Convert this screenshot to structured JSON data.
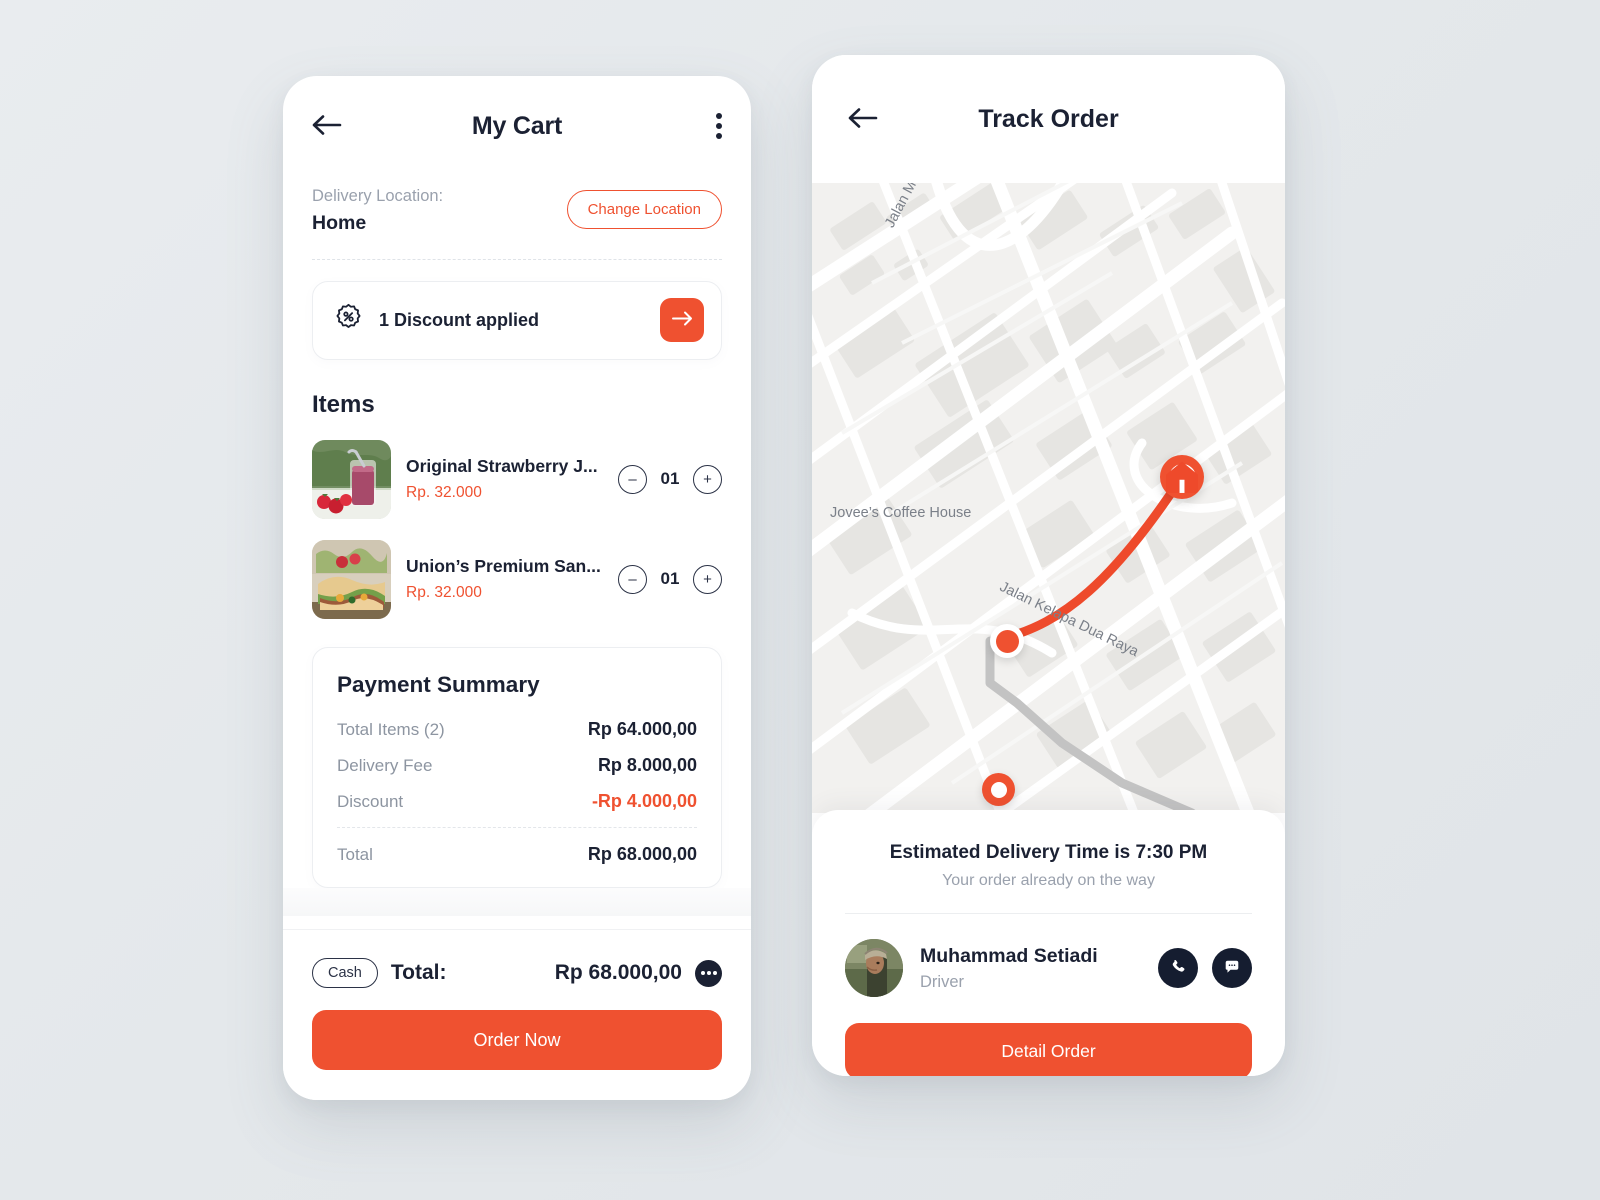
{
  "theme": {
    "accent": "#ef5130",
    "dark": "#1b2133",
    "muted": "#9aa1ad",
    "page_bg": "#e6e9ec"
  },
  "cart": {
    "title": "My Cart",
    "back_icon": "arrow-left-icon",
    "menu_icon": "more-vertical-icon",
    "delivery": {
      "label": "Delivery Location:",
      "value": "Home",
      "change_button": "Change Location"
    },
    "discount": {
      "icon": "discount-badge-icon",
      "text": "1 Discount applied",
      "action_icon": "arrow-right-icon"
    },
    "items_heading": "Items",
    "items": [
      {
        "name": "Original Strawberry J...",
        "price": "Rp. 32.000",
        "quantity": "01",
        "decrement": "–",
        "increment": "+",
        "thumb": "strawberry-smoothie-photo"
      },
      {
        "name": "Union’s Premium San...",
        "price": "Rp. 32.000",
        "quantity": "01",
        "decrement": "–",
        "increment": "+",
        "thumb": "sandwich-photo"
      }
    ],
    "payment_summary": {
      "title": "Payment Summary",
      "rows": [
        {
          "key": "Total Items (2)",
          "value": "Rp 64.000,00",
          "negative": false
        },
        {
          "key": "Delivery Fee",
          "value": "Rp 8.000,00",
          "negative": false
        },
        {
          "key": "Discount",
          "value": "-Rp 4.000,00",
          "negative": true
        }
      ],
      "total_key": "Total",
      "total_value": "Rp 68.000,00"
    },
    "bottom": {
      "payment_method": "Cash",
      "total_label": "Total:",
      "total_amount": "Rp 68.000,00",
      "more_icon": "more-horizontal-icon",
      "order_button": "Order Now"
    }
  },
  "track": {
    "title": "Track Order",
    "back_icon": "arrow-left-icon",
    "map": {
      "labels": [
        {
          "name": "Jalan Mission Drive"
        },
        {
          "name": "Jovee’s Coffee House"
        },
        {
          "name": "Jalan Kelapa Dua Raya"
        }
      ],
      "markers": [
        {
          "name": "destination-home-marker",
          "icon": "home-icon"
        },
        {
          "name": "driver-current-marker",
          "icon": "filled-dot-icon"
        },
        {
          "name": "origin-marker",
          "icon": "hollow-dot-icon"
        }
      ]
    },
    "eta": "Estimated Delivery Time is 7:30 PM",
    "eta_sub": "Your order already on the way",
    "driver": {
      "avatar": "driver-portrait-photo",
      "name": "Muhammad Setiadi",
      "role": "Driver",
      "call_icon": "phone-icon",
      "chat_icon": "chat-bubble-icon"
    },
    "detail_button": "Detail Order"
  }
}
